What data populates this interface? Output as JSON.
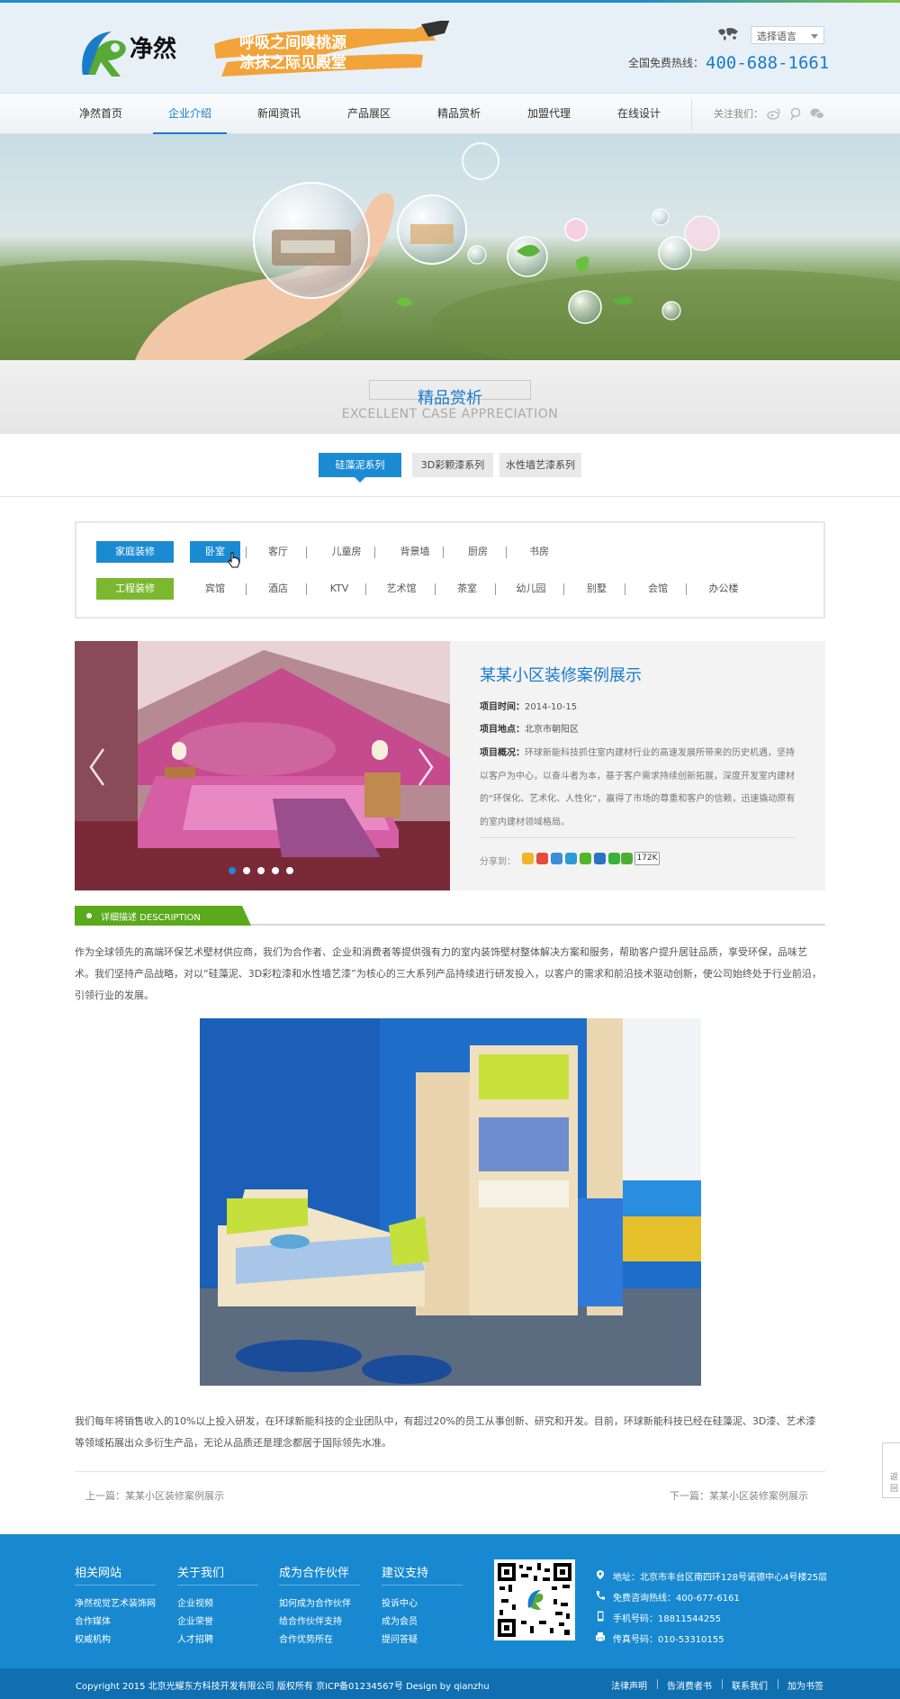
{
  "header": {
    "logo_text": "净然",
    "slogan_line1": "呼吸之间嗅桃源",
    "slogan_line2": "涂抹之际见殿堂",
    "language_select": "选择语言",
    "hotline_label": "全国免费热线：",
    "hotline_number": "400-688-1661"
  },
  "nav": {
    "items": [
      "净然首页",
      "企业介绍",
      "新闻资讯",
      "产品展区",
      "精品赏析",
      "加盟代理",
      "在线设计"
    ],
    "active_index": 1,
    "follow_label": "关注我们："
  },
  "section": {
    "title": "精品赏析",
    "subtitle": "EXCELLENT CASE APPRECIATION"
  },
  "series_tabs": [
    "硅藻泥系列",
    "3D彩颗漆系列",
    "水性墙艺漆系列"
  ],
  "filter": {
    "home_label": "家庭装修",
    "home_options": [
      "卧室",
      "客厅",
      "儿童房",
      "背景墙",
      "厨房",
      "书房"
    ],
    "eng_label": "工程装修",
    "eng_options": [
      "宾馆",
      "酒店",
      "KTV",
      "艺术馆",
      "茶室",
      "幼儿园",
      "别墅",
      "会馆",
      "办公楼"
    ]
  },
  "case": {
    "title": "某某小区装修案例展示",
    "date_label": "项目时间：",
    "date_value": "2014-10-15",
    "location_label": "项目地点：",
    "location_value": "北京市朝阳区",
    "overview_label": "项目概况：",
    "overview_text": "环球新能科技抓住室内建材行业的高速发展所带来的历史机遇，坚持以客户为中心，以奋斗者为本，基于客户需求持续创新拓展，深度开发室内建材的“环保化、艺术化、人性化”，赢得了市场的尊重和客户的信赖，迅速撬动原有的室内建材领域格局。",
    "share_label": "分享到：",
    "share_count": "172K",
    "slide_count": 5,
    "active_slide": 0
  },
  "description": {
    "tag": "详细描述 DESCRIPTION",
    "para1": "作为全球领先的高端环保艺术壁材供应商，我们为合作者、企业和消费者等提供强有力的室内装饰壁材整体解决方案和服务，帮助客户提升居驻品质，享受环保，品味艺术。我们坚持产品战略，对以“硅藻泥、3D彩粒漆和水性墙艺漆”为核心的三大系列产品持续进行研发投入，以客户的需求和前沿技术驱动创新，使公司始终处于行业前沿，引领行业的发展。",
    "para2": "我们每年将销售收入的10%以上投入研发，在环球新能科技的企业团队中，有超过20%的员工从事创新、研究和开发。目前，环球新能科技已经在硅藻泥、3D漆、艺术漆等领域拓展出众多衍生产品，无论从品质还是理念都居于国际领先水准。",
    "prev": "上一篇：某某小区装修案例展示",
    "next": "下一篇：某某小区装修案例展示",
    "side_tab": "返回"
  },
  "footer": {
    "columns": [
      {
        "title": "相关网站",
        "links": [
          "净然视觉艺术装饰网",
          "合作媒体",
          "权威机构"
        ]
      },
      {
        "title": "关于我们",
        "links": [
          "企业视频",
          "企业荣誉",
          "人才招聘"
        ]
      },
      {
        "title": "成为合作伙伴",
        "links": [
          "如何成为合作伙伴",
          "给合作伙伴支持",
          "合作优势所在"
        ]
      },
      {
        "title": "建议支持",
        "links": [
          "投诉中心",
          "成为会员",
          "提问答疑"
        ]
      }
    ],
    "address": "地址：北京市丰台区南四环128号诺德中心4号楼25层",
    "consult": "免费咨询热线：400-677-6161",
    "mobile": "手机号码：18811544255",
    "fax": "传真号码：010-53310155",
    "copyright": "Copyright 2015 北京光耀东方科技开发有限公司 版权所有  京ICP备01234567号  Design by qianzhu",
    "bottom_links": [
      "法律声明",
      "告消费者书",
      "联系我们",
      "加为书签"
    ]
  },
  "colors": {
    "accent_blue": "#1a8bd2",
    "accent_green": "#7cb82f",
    "footer_blue": "#1889d0"
  }
}
